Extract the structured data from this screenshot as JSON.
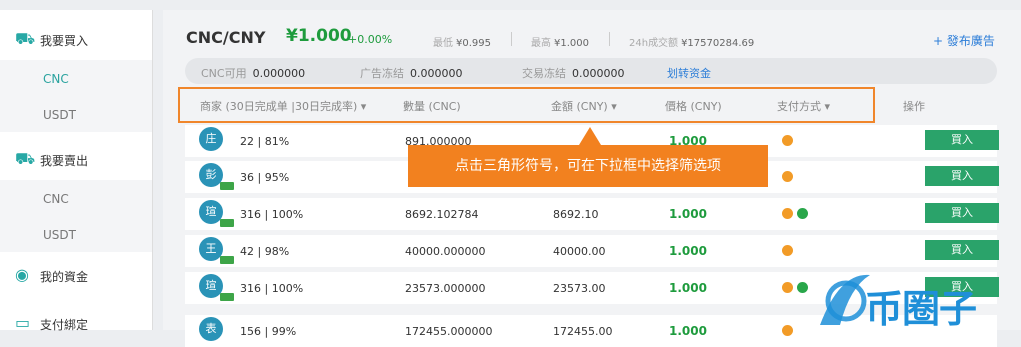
{
  "sidebar": {
    "buy_group": "我要買入",
    "buy_items": [
      "CNC",
      "USDT"
    ],
    "sell_group": "我要賣出",
    "sell_items": [
      "CNC",
      "USDT"
    ],
    "funds": "我的資金",
    "payment": "支付綁定"
  },
  "header": {
    "pair": "CNC/CNY",
    "price": "¥1.000",
    "change": "+0.00%",
    "low_label": "最低",
    "low": "¥0.995",
    "high_label": "最高",
    "high": "¥1.000",
    "vol_label": "24h成交额",
    "vol": "¥17570284.69",
    "publish": "+ 發布廣告"
  },
  "balance": {
    "avail_label": "CNC可用",
    "avail": "0.000000",
    "ad_label": "广告冻结",
    "ad": "0.000000",
    "trade_label": "交易冻结",
    "trade": "0.000000",
    "transfer": "划转资金"
  },
  "table": {
    "headers": {
      "merchant": "商家 (30日完成单 |30日完成率) ▾",
      "qty": "數量 (CNC)",
      "amount": "金額 (CNY) ▾",
      "price": "價格 (CNY)",
      "pay": "支付方式 ▾",
      "op": "操作"
    },
    "rows": [
      {
        "avatar": "庄",
        "stats": "22 | 81%",
        "qty": "891.000000",
        "amount": "",
        "price": "1.000",
        "buy": "買入"
      },
      {
        "avatar": "彭",
        "stats": "36 | 95%",
        "qty": "",
        "amount": "",
        "price": "",
        "buy": "買入"
      },
      {
        "avatar": "瑄",
        "stats": "316 | 100%",
        "qty": "8692.102784",
        "amount": "8692.10",
        "price": "1.000",
        "buy": "買入"
      },
      {
        "avatar": "王",
        "stats": "42 | 98%",
        "qty": "40000.000000",
        "amount": "40000.00",
        "price": "1.000",
        "buy": "買入"
      },
      {
        "avatar": "瑄",
        "stats": "316 | 100%",
        "qty": "23573.000000",
        "amount": "23573.00",
        "price": "1.000",
        "buy": "買入"
      },
      {
        "avatar": "表",
        "stats": "156 | 99%",
        "qty": "172455.000000",
        "amount": "172455.00",
        "price": "1.000",
        "buy": "買入"
      }
    ]
  },
  "tooltip": "点击三角形符号，可在下拉框中选择筛选项",
  "watermark": "币圈子",
  "colors": {
    "accent": "#f2811f",
    "green": "#1e9b3d",
    "teal": "#2aa39f",
    "blue": "#2d7ed8"
  }
}
